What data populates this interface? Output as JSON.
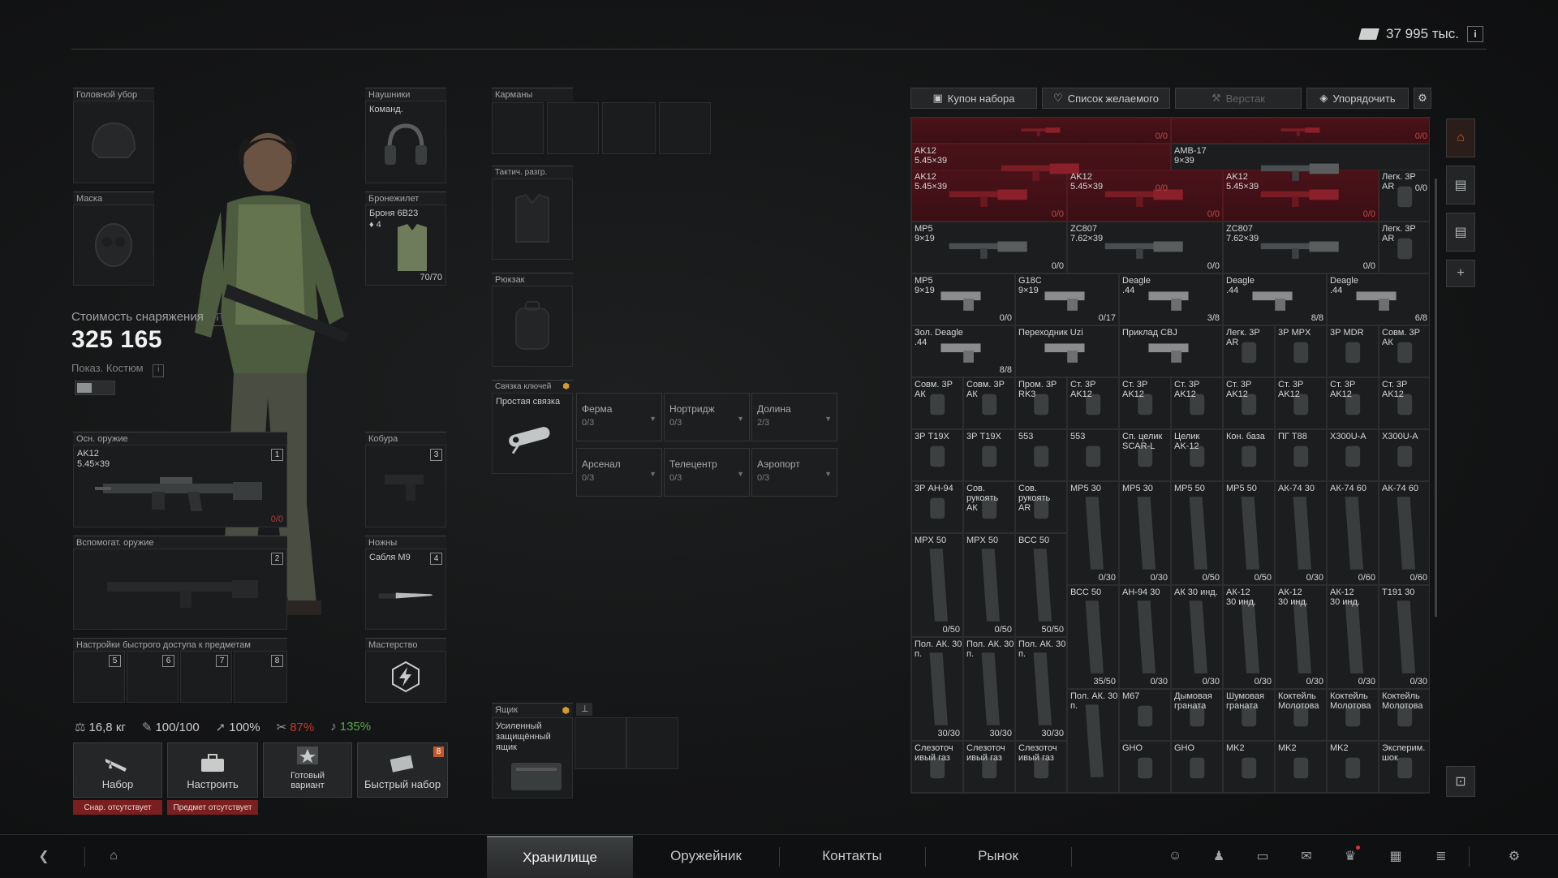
{
  "currency": {
    "amount": "37 995 тыс.",
    "info": "i"
  },
  "slots": {
    "headwear": {
      "label": "Головной убор"
    },
    "earpiece": {
      "label": "Наушники",
      "item": "Команд."
    },
    "face": {
      "label": "Маска"
    },
    "armor": {
      "label": "Бронежилет",
      "item": "Броня 6В23",
      "class": "4",
      "durability": "70/70"
    },
    "pockets": {
      "label": "Карманы"
    },
    "rig": {
      "label": "Тактич. разгр."
    },
    "backpack": {
      "label": "Рюкзак"
    },
    "keychain": {
      "label": "Связка ключей",
      "item": "Простая связка"
    },
    "primary": {
      "label": "Осн. оружие",
      "item": "AK12\n5.45×39",
      "ammo": "0/0",
      "num": "1"
    },
    "secondary": {
      "label": "Вспомогат. оружие",
      "num": "2"
    },
    "holster": {
      "label": "Кобура",
      "num": "3"
    },
    "scabbard": {
      "label": "Ножны",
      "item": "Сабля М9",
      "num": "4"
    },
    "quickslots": {
      "label": "Настройки быстрого доступа к предметам",
      "nums": [
        "5",
        "6",
        "7",
        "8"
      ]
    },
    "mastery": {
      "label": "Мастерство"
    },
    "case": {
      "label": "Ящик",
      "item": "Усиленный\nзащищённый\nящик"
    }
  },
  "keys": [
    {
      "name": "Ферма",
      "count": "0/3"
    },
    {
      "name": "Нортридж",
      "count": "0/3"
    },
    {
      "name": "Долина",
      "count": "2/3"
    },
    {
      "name": "Арсенал",
      "count": "0/3"
    },
    {
      "name": "Телецентр",
      "count": "0/3"
    },
    {
      "name": "Аэропорт",
      "count": "0/3"
    }
  ],
  "gear_cost": {
    "title": "Стоимость снаряжения",
    "value": "325 165",
    "costume": "Показ. Костюм"
  },
  "stats": {
    "weight": "16,8 кг",
    "stamina": "100/100",
    "move": "100%",
    "ergo": "87%",
    "hydr": "135%"
  },
  "actions": [
    {
      "label": "Набор",
      "warning": "Снар. отсутствует"
    },
    {
      "label": "Настроить",
      "warning": "Предмет отсутствует"
    },
    {
      "label": "Готовый\nвариант"
    },
    {
      "label": "Быстрый набор",
      "badge": "8"
    }
  ],
  "stash_tabs": [
    {
      "label": "Купон набора"
    },
    {
      "label": "Список желаемого"
    },
    {
      "label": "Верстак"
    },
    {
      "label": "Упорядочить"
    }
  ],
  "stash_items": [
    {
      "n": "",
      "c": "0/0",
      "red": true
    },
    {
      "n": "",
      "c": "0/0",
      "red": true
    },
    {
      "n": "AK12\n5.45×39",
      "c": "0/0",
      "red": true
    },
    {
      "n": "AMB-17\n9×39",
      "c": "0/0"
    },
    {
      "n": "AK12\n5.45×39",
      "c": "0/0",
      "red": true
    },
    {
      "n": "AK12\n5.45×39",
      "c": "0/0",
      "red": true
    },
    {
      "n": "AK12\n5.45×39",
      "c": "0/0",
      "red": true
    },
    {
      "n": "Легк. 3Р\nAR",
      "c": ""
    },
    {
      "n": "MP5\n9×19",
      "c": "0/0"
    },
    {
      "n": "ZC807\n7.62×39",
      "c": "0/0"
    },
    {
      "n": "ZC807\n7.62×39",
      "c": "0/0"
    },
    {
      "n": "Легк. 3Р\nAR",
      "c": ""
    },
    {
      "n": "MP5\n9×19",
      "c": "0/0"
    },
    {
      "n": "G18C\n9×19",
      "c": "0/17"
    },
    {
      "n": "Deagle\n.44",
      "c": "3/8"
    },
    {
      "n": "Deagle\n.44",
      "c": "8/8"
    },
    {
      "n": "Deagle\n.44",
      "c": "6/8"
    },
    {
      "n": "Зол. Deagle\n.44",
      "c": "8/8"
    },
    {
      "n": "Переходник Uzi",
      "c": ""
    },
    {
      "n": "Приклад CBJ",
      "c": ""
    },
    {
      "n": "Легк. 3Р\nAR",
      "c": ""
    },
    {
      "n": "3Р MPX",
      "c": ""
    },
    {
      "n": "3Р MDR",
      "c": ""
    },
    {
      "n": "Совм. 3Р\nАК",
      "c": ""
    },
    {
      "n": "Совм. 3Р\nАК",
      "c": ""
    },
    {
      "n": "Совм. 3Р\nАК",
      "c": ""
    },
    {
      "n": "Пром. 3Р\nRK3",
      "c": ""
    },
    {
      "n": "Ст. 3Р\nAK12",
      "c": ""
    },
    {
      "n": "Ст. 3Р\nAK12",
      "c": ""
    },
    {
      "n": "Ст. 3Р\nAK12",
      "c": ""
    },
    {
      "n": "Ст. 3Р\nAK12",
      "c": ""
    },
    {
      "n": "Ст. 3Р\nAK12",
      "c": ""
    },
    {
      "n": "Ст. 3Р\nAK12",
      "c": ""
    },
    {
      "n": "Ст. 3Р\nAK12",
      "c": ""
    },
    {
      "n": "3Р T19X",
      "c": ""
    },
    {
      "n": "3Р T19X",
      "c": ""
    },
    {
      "n": "553",
      "c": ""
    },
    {
      "n": "553",
      "c": ""
    },
    {
      "n": "Сп. целик\nSCAR-L",
      "c": ""
    },
    {
      "n": "Целик\nAK-12",
      "c": ""
    },
    {
      "n": "Кон. база",
      "c": ""
    },
    {
      "n": "ПГ T88",
      "c": ""
    },
    {
      "n": "X300U-A",
      "c": ""
    },
    {
      "n": "X300U-A",
      "c": ""
    },
    {
      "n": "3Р АН-94",
      "c": ""
    },
    {
      "n": "Сов.\nрукоять\nАК",
      "c": ""
    },
    {
      "n": "Сов.\nрукоять\nAR",
      "c": ""
    },
    {
      "n": "MP5 30",
      "c": "0/30"
    },
    {
      "n": "MP5 30",
      "c": "0/30"
    },
    {
      "n": "MP5 50",
      "c": "0/50"
    },
    {
      "n": "MP5 50",
      "c": "0/50"
    },
    {
      "n": "АК-74 30",
      "c": "0/30"
    },
    {
      "n": "АК-74 60",
      "c": "0/60"
    },
    {
      "n": "АК-74 60",
      "c": "0/60"
    },
    {
      "n": "MPX 50",
      "c": "0/50"
    },
    {
      "n": "MPX 50",
      "c": "0/50"
    },
    {
      "n": "ВСС 50",
      "c": "50/50"
    },
    {
      "n": "ВСС 50",
      "c": "35/50"
    },
    {
      "n": "АН-94 30",
      "c": "0/30"
    },
    {
      "n": "АК 30 инд.",
      "c": "0/30"
    },
    {
      "n": "АК-12\n30 инд.",
      "c": "0/30"
    },
    {
      "n": "АК-12\n30 инд.",
      "c": "0/30"
    },
    {
      "n": "АК-12\n30 инд.",
      "c": "0/30"
    },
    {
      "n": "T191 30",
      "c": "0/30"
    },
    {
      "n": "Пол. АК. 30\nп.",
      "c": "30/30"
    },
    {
      "n": "Пол. АК. 30\nп.",
      "c": "30/30"
    },
    {
      "n": "Пол. АК. 30\nп.",
      "c": "30/30"
    },
    {
      "n": "Пол. АК. 30\nп.",
      "c": ""
    },
    {
      "n": "M67",
      "c": ""
    },
    {
      "n": "Дымовая\nграната",
      "c": ""
    },
    {
      "n": "Шумовая\nграната",
      "c": ""
    },
    {
      "n": "Коктейль\nМолотова",
      "c": ""
    },
    {
      "n": "Коктейль\nМолотова",
      "c": ""
    },
    {
      "n": "Коктейль\nМолотова",
      "c": ""
    },
    {
      "n": "Слезоточ\nивый газ",
      "c": ""
    },
    {
      "n": "Слезоточ\nивый газ",
      "c": ""
    },
    {
      "n": "Слезоточ\nивый газ",
      "c": ""
    },
    {
      "n": "GHO",
      "c": ""
    },
    {
      "n": "GHO",
      "c": ""
    },
    {
      "n": "MK2",
      "c": ""
    },
    {
      "n": "MK2",
      "c": ""
    },
    {
      "n": "MK2",
      "c": ""
    },
    {
      "n": "Эксперим.\nшок",
      "c": ""
    }
  ],
  "nav": {
    "tabs": [
      "Хранилище",
      "Оружейник",
      "Контакты",
      "Рынок"
    ]
  },
  "colors": {
    "danger": "#7a1f1f",
    "accent_green": "#5aa64b",
    "accent_red": "#c0392b"
  }
}
